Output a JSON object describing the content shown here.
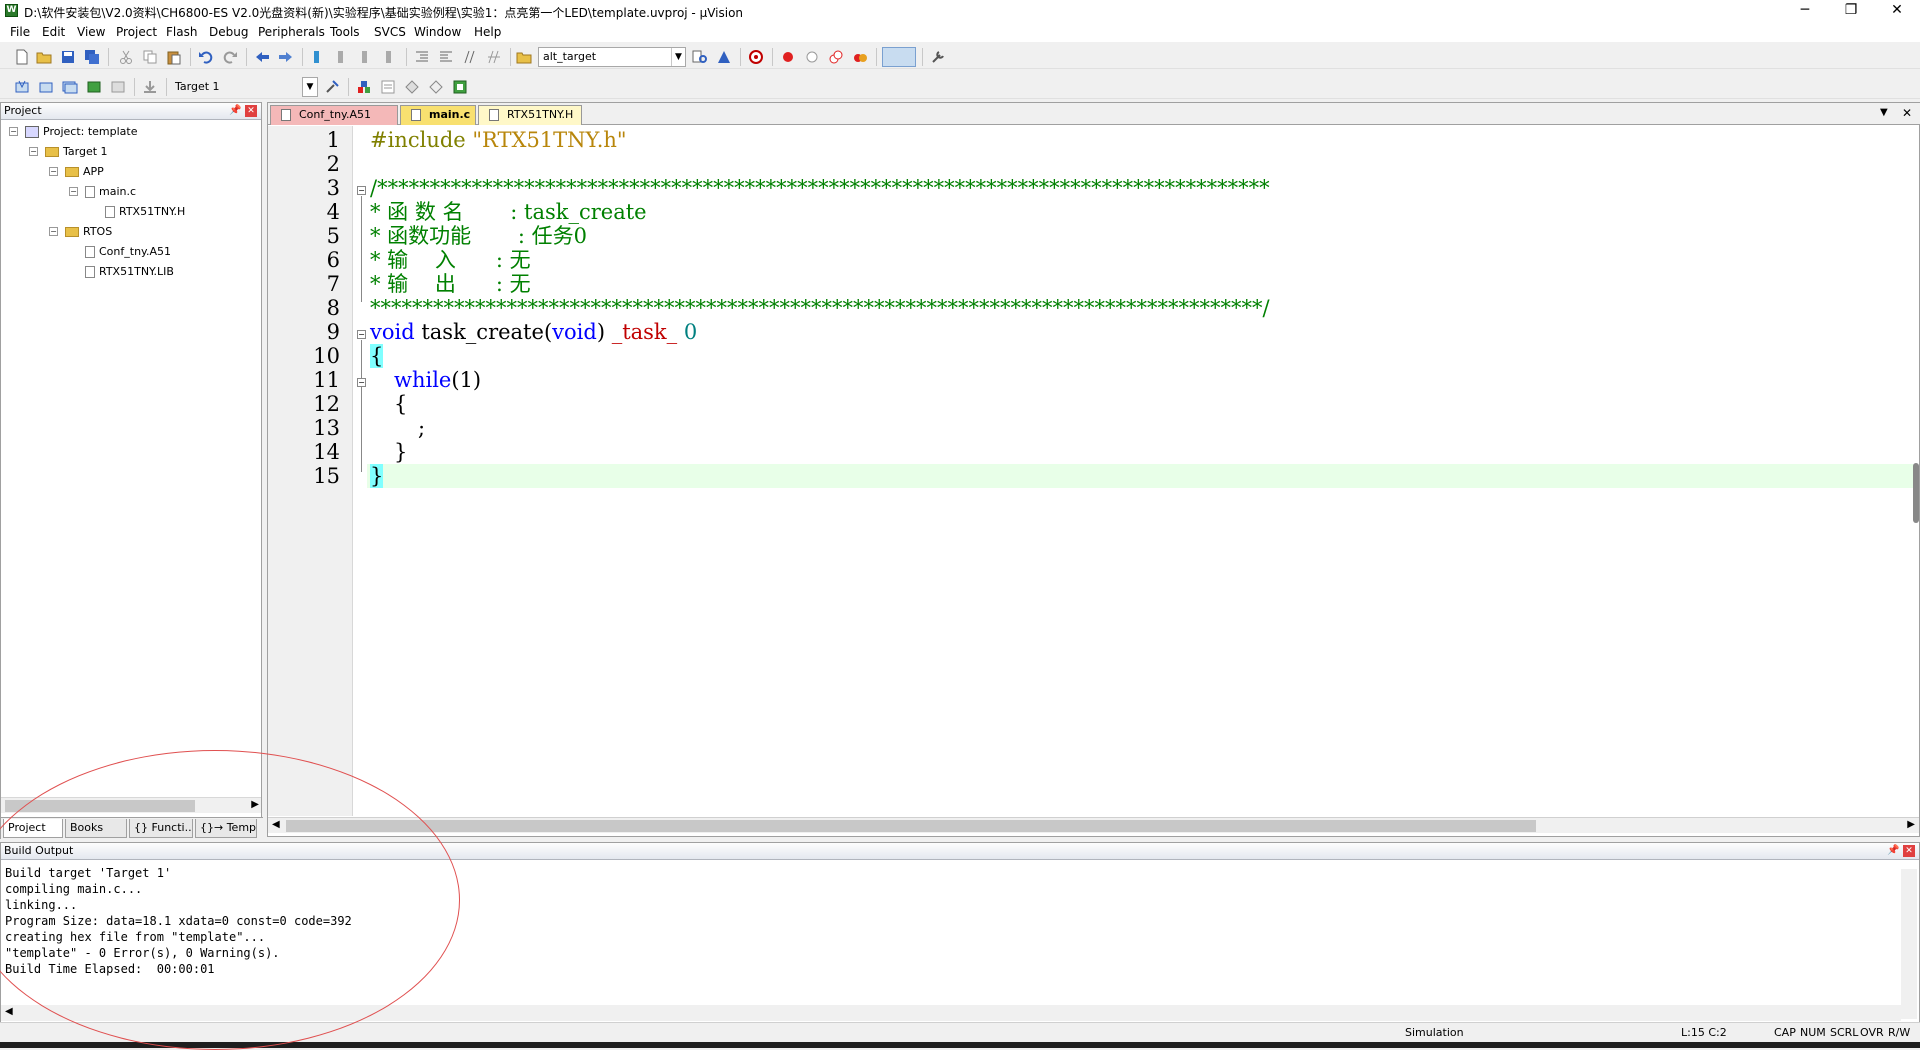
{
  "title": "D:\\软件安装包\\V2.0资料\\CH6800-ES V2.0光盘资料(新)\\实验程序\\基础实验例程\\实验1：点亮第一个LED\\template.uvproj - µVision",
  "menu": [
    "File",
    "Edit",
    "View",
    "Project",
    "Flash",
    "Debug",
    "Peripherals",
    "Tools",
    "SVCS",
    "Window",
    "Help"
  ],
  "toolbar": {
    "find_combo": "alt_target",
    "target_combo": "Target 1"
  },
  "project_panel": {
    "header": "Project",
    "tree": {
      "project": "Project: template",
      "target": "Target 1",
      "group_app": "APP",
      "file_main": "main.c",
      "file_rtx_h": "RTX51TNY.H",
      "group_rtos": "RTOS",
      "file_conf": "Conf_tny.A51",
      "file_lib": "RTX51TNY.LIB"
    },
    "tabs": [
      "Project",
      "Books",
      "{} Functi...",
      "{}→ Templ..."
    ]
  },
  "editor": {
    "tabs": [
      "Conf_tny.A51",
      "main.c",
      "RTX51TNY.H"
    ],
    "line_numbers": [
      "1",
      "2",
      "3",
      "4",
      "5",
      "6",
      "7",
      "8",
      "9",
      "10",
      "11",
      "12",
      "13",
      "14",
      "15"
    ],
    "code": {
      "l1_pp": "#include ",
      "l1_str": "\"RTX51TNY.h\"",
      "l3": "/*************************************************************************************",
      "l4": "* 函 数 名       : task_create",
      "l5": "* 函数功能       : 任务0",
      "l6": "* 输    入      : 无",
      "l7": "* 输    出      : 无",
      "l8": "*************************************************************************************/",
      "l9_kw1": "void",
      "l9_mid": " task_create",
      "l9_p1": "(",
      "l9_kw2": "void",
      "l9_p2": ") ",
      "l9_mac": "_task_",
      "l9_num": " 0",
      "l10": "{",
      "l11_kw": "while",
      "l11_rest": "(1)",
      "l12": "{",
      "l13": ";",
      "l14": "}",
      "l15": "}"
    }
  },
  "build_output": {
    "header": "Build Output",
    "lines": [
      "Build target 'Target 1'",
      "compiling main.c...",
      "linking...",
      "Program Size: data=18.1 xdata=0 const=0 code=392",
      "creating hex file from \"template\"...",
      "\"template\" - 0 Error(s), 0 Warning(s).",
      "Build Time Elapsed:  00:00:01"
    ]
  },
  "status": {
    "mode": "Simulation",
    "cursor": "L:15 C:2",
    "cap": "CAP",
    "num": "NUM",
    "scrl": "SCRL",
    "ovr": "OVR",
    "rw": "R/W"
  },
  "colors": {
    "keyword": "#0000ff",
    "comment": "#008000",
    "string": "#b8860b",
    "macro": "#c00000",
    "current_line": "#e8ffe8"
  }
}
